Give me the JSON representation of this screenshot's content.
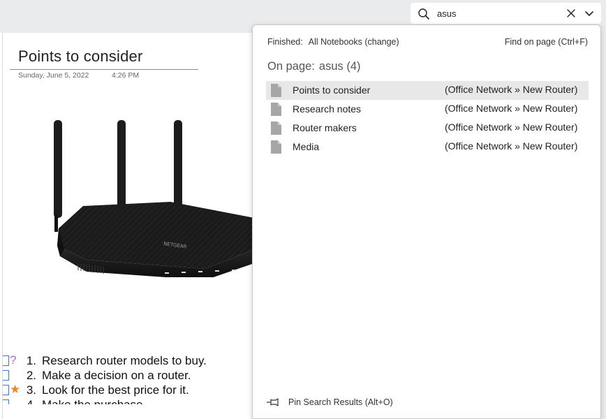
{
  "search": {
    "value": "asus",
    "placeholder": ""
  },
  "page": {
    "title": "Points to consider",
    "date": "Sunday, June 5, 2022",
    "time": "4:26 PM",
    "image_brand": "NETGEAR",
    "todo": [
      {
        "tag": "?",
        "num": "1.",
        "text": "Research router models to buy."
      },
      {
        "tag": "",
        "num": "2.",
        "text": "Make a decision on a router."
      },
      {
        "tag": "★",
        "num": "3.",
        "text": "Look for the best price for it."
      },
      {
        "tag": "",
        "num": "4.",
        "text": "Make the purchase"
      }
    ]
  },
  "results": {
    "finished_label": "Finished:",
    "scope": "All Notebooks (change)",
    "find_on_page": "Find on page (Ctrl+F)",
    "on_page_label": "On page:",
    "on_page_summary": "asus (4)",
    "items": [
      {
        "title": "Points to consider",
        "path": "(Office Network » New Router)"
      },
      {
        "title": "Research notes",
        "path": "(Office Network » New Router)"
      },
      {
        "title": "Router makers",
        "path": "(Office Network » New Router)"
      },
      {
        "title": "Media",
        "path": "(Office Network » New Router)"
      }
    ],
    "pin_label": "Pin Search Results (Alt+O)"
  },
  "colors": {
    "tag_question": "#b06ad0",
    "tag_star": "#e8872a",
    "todo_box": "#3b78c6",
    "selected_row": "#e8e8e8"
  }
}
